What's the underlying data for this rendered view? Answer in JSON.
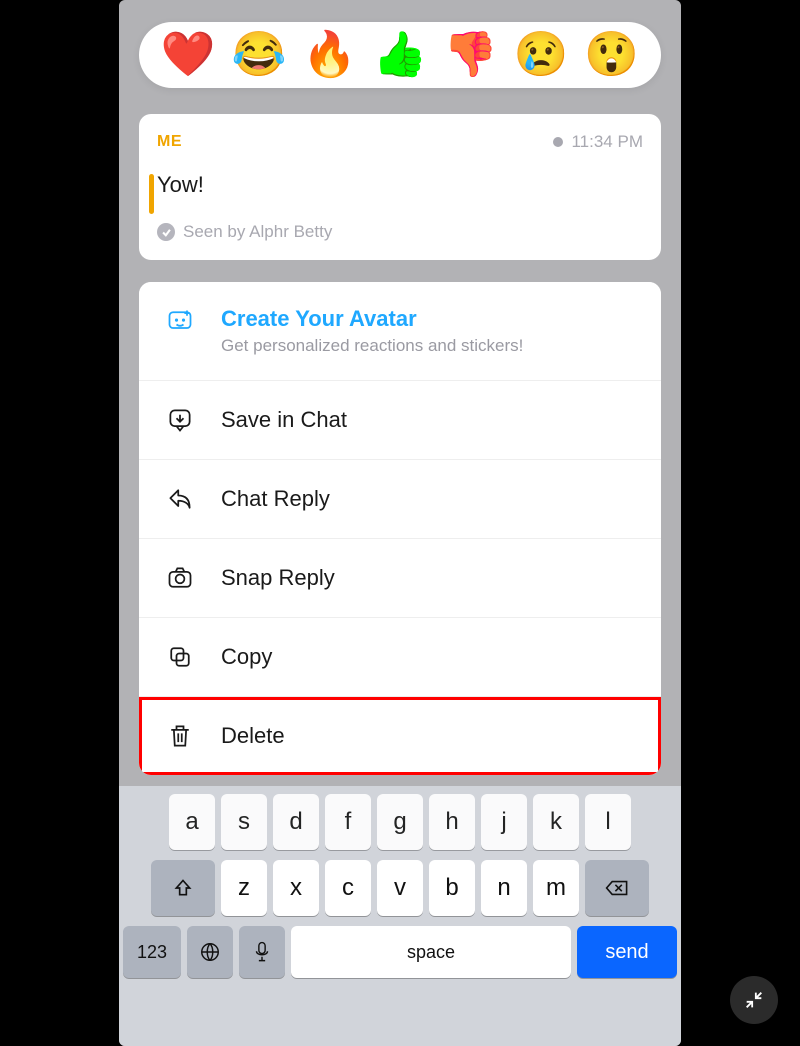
{
  "reactions": [
    "❤️",
    "😂",
    "🔥",
    "👍",
    "👎",
    "😢",
    "😲"
  ],
  "message": {
    "sender": "ME",
    "time": "11:34 PM",
    "text": "Yow!",
    "seen_by": "Seen by Alphr Betty"
  },
  "avatar_promo": {
    "title": "Create Your Avatar",
    "subtitle": "Get personalized reactions and stickers!"
  },
  "menu": {
    "save": "Save in Chat",
    "chat_reply": "Chat Reply",
    "snap_reply": "Snap Reply",
    "copy": "Copy",
    "delete": "Delete"
  },
  "keyboard": {
    "row1": [
      "a",
      "s",
      "d",
      "f",
      "g",
      "h",
      "j",
      "k",
      "l"
    ],
    "row2": [
      "z",
      "x",
      "c",
      "v",
      "b",
      "n",
      "m"
    ],
    "numkey": "123",
    "space": "space",
    "send": "send"
  }
}
